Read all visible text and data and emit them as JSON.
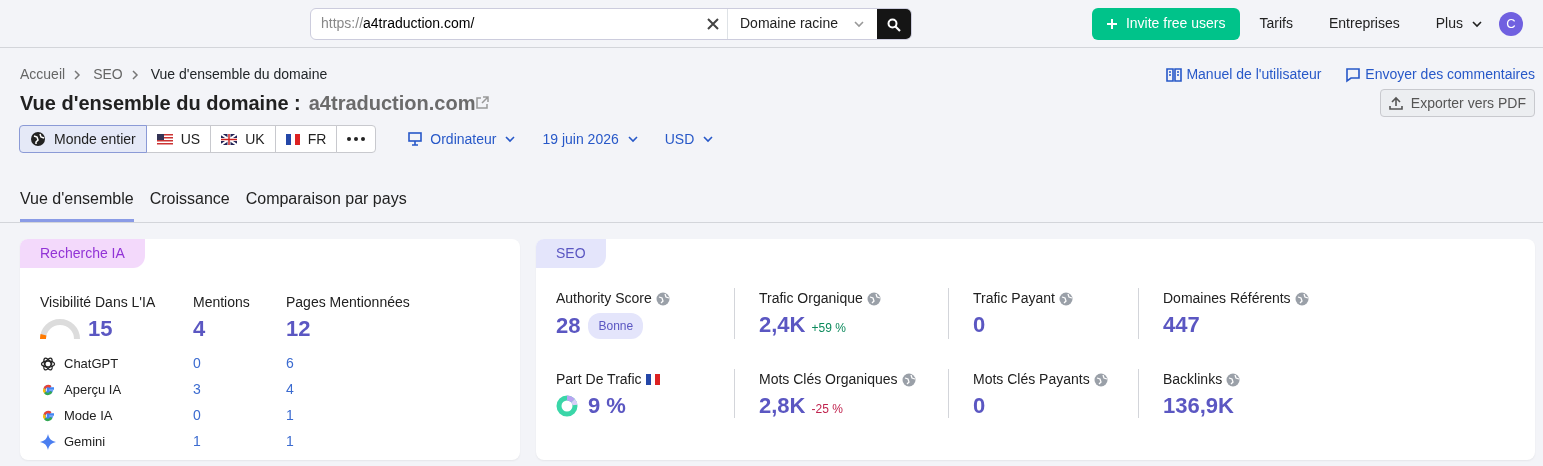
{
  "search": {
    "prefix": "https://",
    "value": "a4traduction.com/",
    "scope": "Domaine racine"
  },
  "topnav": {
    "invite_button": "Invite free users",
    "links": [
      "Tarifs",
      "Entreprises",
      "Plus"
    ],
    "avatar": "C"
  },
  "breadcrumb": [
    "Accueil",
    "SEO",
    "Vue d'ensemble du domaine"
  ],
  "help_links": [
    {
      "kind": "manual",
      "label": "Manuel de l'utilisateur"
    },
    {
      "kind": "feedback",
      "label": "Envoyer des commentaires"
    }
  ],
  "title": {
    "text": "Vue d'ensemble du domaine :",
    "domain": "a4traduction.com"
  },
  "export_button": "Exporter vers PDF",
  "regions": [
    {
      "kind": "world",
      "label": "Monde entier",
      "selected": true
    },
    {
      "kind": "us",
      "label": "US",
      "selected": false
    },
    {
      "kind": "uk",
      "label": "UK",
      "selected": false
    },
    {
      "kind": "fr",
      "label": "FR",
      "selected": false
    }
  ],
  "filters": [
    {
      "kind": "device",
      "label": "Ordinateur"
    },
    {
      "kind": "plain",
      "label": "19 juin 2026"
    },
    {
      "kind": "plain",
      "label": "USD"
    }
  ],
  "tabs": [
    {
      "label": "Vue d'ensemble",
      "selected": true
    },
    {
      "label": "Croissance",
      "selected": false
    },
    {
      "label": "Comparaison par pays",
      "selected": false
    }
  ],
  "ai_card": {
    "title": "Recherche IA",
    "columns": [
      "Visibilité Dans L'IA",
      "Mentions",
      "Pages Mentionnées"
    ],
    "visibility": {
      "value": "15"
    },
    "mentions": "4",
    "pages": "12",
    "rows": [
      {
        "kind": "chatgpt",
        "name": "ChatGPT",
        "mentions": "0",
        "pages": "6"
      },
      {
        "kind": "google",
        "name": "Aperçu IA",
        "mentions": "3",
        "pages": "4"
      },
      {
        "kind": "google",
        "name": "Mode IA",
        "mentions": "0",
        "pages": "1"
      },
      {
        "kind": "gemini",
        "name": "Gemini",
        "mentions": "1",
        "pages": "1"
      }
    ]
  },
  "seo_card": {
    "title": "SEO",
    "metrics": [
      {
        "kind": "globe",
        "label": "Authority Score",
        "value": "28",
        "badge": "Bonne"
      },
      {
        "kind": "globe",
        "label": "Trafic Organique",
        "value": "2,4K",
        "change": {
          "kind": "increase",
          "text": "+59 %"
        }
      },
      {
        "kind": "globe",
        "label": "Trafic Payant",
        "value": "0"
      },
      {
        "kind": "globe",
        "label": "Domaines Référents",
        "value": "447"
      },
      {
        "kind": "share",
        "label": "Part De Trafic",
        "value": "9 %"
      },
      {
        "kind": "globe",
        "label": "Mots Clés Organiques",
        "value": "2,8K",
        "change": {
          "kind": "decrease",
          "text": "-25 %"
        }
      },
      {
        "kind": "globe",
        "label": "Mots Clés Payants",
        "value": "0"
      },
      {
        "kind": "globe",
        "label": "Backlinks",
        "value": "136,9K"
      }
    ]
  }
}
